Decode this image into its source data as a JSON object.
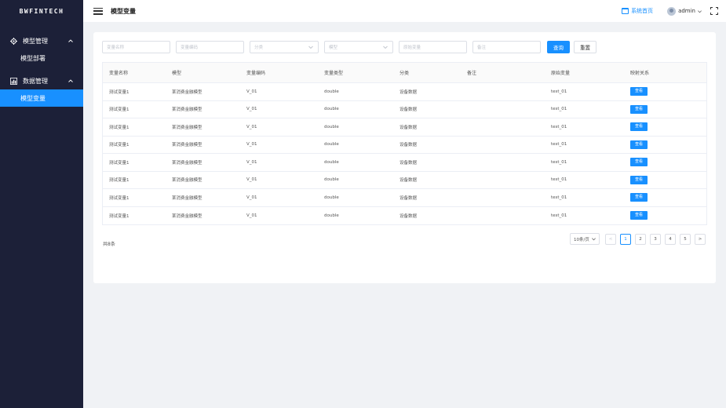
{
  "sidebar": {
    "logo": "BWFINTECH",
    "groups": [
      {
        "icon": "settings-gear-icon",
        "label": "模型管理",
        "items": [
          {
            "label": "模型部署"
          }
        ]
      },
      {
        "icon": "bar-chart-icon",
        "label": "数据管理",
        "items": [
          {
            "label": "模型变量"
          }
        ]
      }
    ]
  },
  "header": {
    "title": "模型变量",
    "home_link": "系统首页",
    "user": "admin"
  },
  "filters": {
    "var_name": "变量名称",
    "var_code": "变量编码",
    "category": "分类",
    "model": "模型",
    "raw_var": "原始变量",
    "remark": "备注",
    "query_btn": "查询",
    "reset_btn": "重置"
  },
  "table": {
    "columns": [
      "变量名称",
      "模型",
      "变量编码",
      "变量类型",
      "分类",
      "备注",
      "原始变量",
      "映射关系"
    ],
    "rows": [
      [
        "测试变量1",
        "某消费金融模型",
        "V_01",
        "double",
        "设备数据",
        "",
        "test_01",
        "查看"
      ],
      [
        "测试变量1",
        "某消费金融模型",
        "V_01",
        "double",
        "设备数据",
        "",
        "test_01",
        "查看"
      ],
      [
        "测试变量1",
        "某消费金融模型",
        "V_01",
        "double",
        "设备数据",
        "",
        "test_01",
        "查看"
      ],
      [
        "测试变量1",
        "某消费金融模型",
        "V_01",
        "double",
        "设备数据",
        "",
        "test_01",
        "查看"
      ],
      [
        "测试变量1",
        "某消费金融模型",
        "V_01",
        "double",
        "设备数据",
        "",
        "test_01",
        "查看"
      ],
      [
        "测试变量1",
        "某消费金融模型",
        "V_01",
        "double",
        "设备数据",
        "",
        "test_01",
        "查看"
      ],
      [
        "测试变量1",
        "某消费金融模型",
        "V_01",
        "double",
        "设备数据",
        "",
        "test_01",
        "查看"
      ],
      [
        "测试变量1",
        "某消费金融模型",
        "V_01",
        "double",
        "设备数据",
        "",
        "test_01",
        "查看"
      ]
    ]
  },
  "pagination": {
    "total": "共8条",
    "page_size": "10条/页",
    "prev": "<",
    "pages": [
      "1",
      "2",
      "3",
      "4",
      "5"
    ],
    "next": ">"
  },
  "colors": {
    "primary": "#1890ff",
    "sidebar": "#1c2038",
    "background": "#f0f2f5"
  }
}
